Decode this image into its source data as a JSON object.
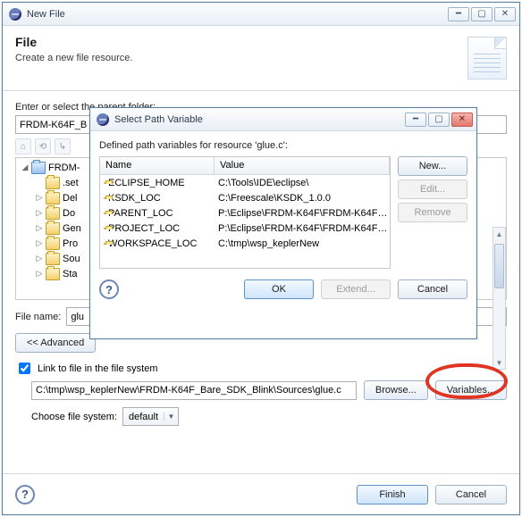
{
  "main": {
    "title": "New File",
    "heading": "File",
    "subheading": "Create a new file resource.",
    "parent_label": "Enter or select the parent folder:",
    "parent_value": "FRDM-K64F_B",
    "tree": {
      "root": "FRDM-",
      "items": [
        ".set",
        "Del",
        "Do",
        "Gen",
        "Pro",
        "Sou",
        "Sta"
      ]
    },
    "filename_label": "File name:",
    "filename_value": "glu",
    "advanced_btn": "<< Advanced",
    "link_checkbox": "Link to file in the file system",
    "link_value": "C:\\tmp\\wsp_keplerNew\\FRDM-K64F_Bare_SDK_Blink\\Sources\\glue.c",
    "browse_btn": "Browse...",
    "variables_btn": "Variables...",
    "choose_label": "Choose file system:",
    "choose_value": "default",
    "finish_btn": "Finish",
    "cancel_btn": "Cancel"
  },
  "dlg": {
    "title": "Select Path Variable",
    "desc": "Defined path variables for resource 'glue.c':",
    "col_name": "Name",
    "col_value": "Value",
    "rows": [
      {
        "name": "ECLIPSE_HOME",
        "value": "C:\\Tools\\IDE\\eclipse\\"
      },
      {
        "name": "KSDK_LOC",
        "value": "C:\\Freescale\\KSDK_1.0.0"
      },
      {
        "name": "PARENT_LOC",
        "value": "P:\\Eclipse\\FRDM-K64F\\FRDM-K64F_..."
      },
      {
        "name": "PROJECT_LOC",
        "value": "P:\\Eclipse\\FRDM-K64F\\FRDM-K64F_..."
      },
      {
        "name": "WORKSPACE_LOC",
        "value": "C:\\tmp\\wsp_keplerNew"
      }
    ],
    "new_btn": "New...",
    "edit_btn": "Edit...",
    "remove_btn": "Remove",
    "ok_btn": "OK",
    "extend_btn": "Extend...",
    "cancel_btn": "Cancel"
  }
}
